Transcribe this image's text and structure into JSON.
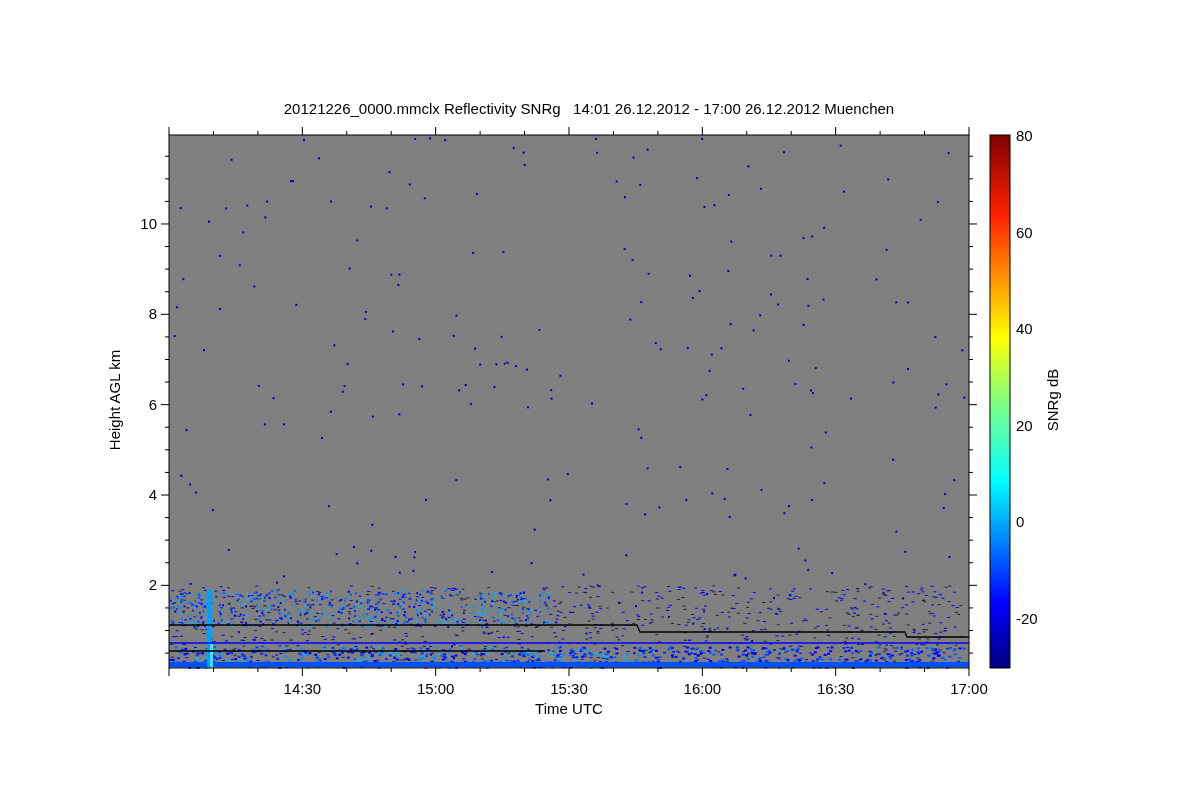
{
  "plot": {
    "title": "20121226_0000.mmclx Reflectivity SNRg   14:01 26.12.2012 - 17:00 26.12.2012 Muenchen",
    "xlabel": "Time UTC",
    "ylabel": "Height AGL km",
    "x_tick_labels": [
      "14:30",
      "15:00",
      "15:30",
      "16:00",
      "16:30",
      "17:00"
    ],
    "y_tick_labels": [
      "10",
      "8",
      "6",
      "4",
      "2"
    ]
  },
  "colorbar": {
    "label": "SNRg dB",
    "ticks": [
      "80",
      "60",
      "40",
      "20",
      "0",
      "-20"
    ]
  }
}
